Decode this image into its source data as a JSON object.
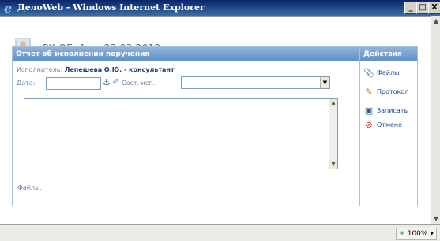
{
  "window": {
    "title": "ДелоWeb - Windows Internet Explorer",
    "minimize": "_",
    "maximize": "□",
    "close": "X"
  },
  "header": {
    "doc_ref": "РК ОГ.-1 от 22.03.2012"
  },
  "report_panel": {
    "title": "Отчет об исполнении поручения",
    "executor_label": "Исполнитель:",
    "executor_value": "Лепешева О.Ю. - консультант",
    "date_label": "Дата:",
    "date_value": "",
    "state_label": "Сост. исп.:",
    "state_value": "",
    "report_text": "",
    "files_label": "Файлы:"
  },
  "actions_panel": {
    "title": "Действия",
    "items": [
      {
        "label": "Файлы",
        "icon": "paperclip-icon"
      },
      {
        "label": "Протокол",
        "icon": "protocol-icon"
      },
      {
        "label": "Записать",
        "icon": "save-icon"
      },
      {
        "label": "Отмена",
        "icon": "cancel-icon"
      }
    ]
  },
  "statusbar": {
    "zoom": "100%"
  },
  "colors": {
    "panel_header": "#6f9bd0",
    "link": "#1f4f9e",
    "label": "#6c85a3"
  }
}
